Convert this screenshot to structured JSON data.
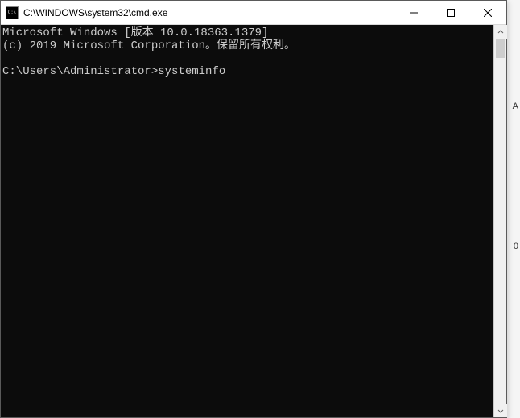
{
  "window": {
    "title": "C:\\WINDOWS\\system32\\cmd.exe"
  },
  "console": {
    "line1": "Microsoft Windows [版本 10.0.18363.1379]",
    "line2": "(c) 2019 Microsoft Corporation。保留所有权利。",
    "blank": "",
    "prompt": "C:\\Users\\Administrator>",
    "command": "systeminfo"
  },
  "background": {
    "char1": "A",
    "char2": "0"
  }
}
